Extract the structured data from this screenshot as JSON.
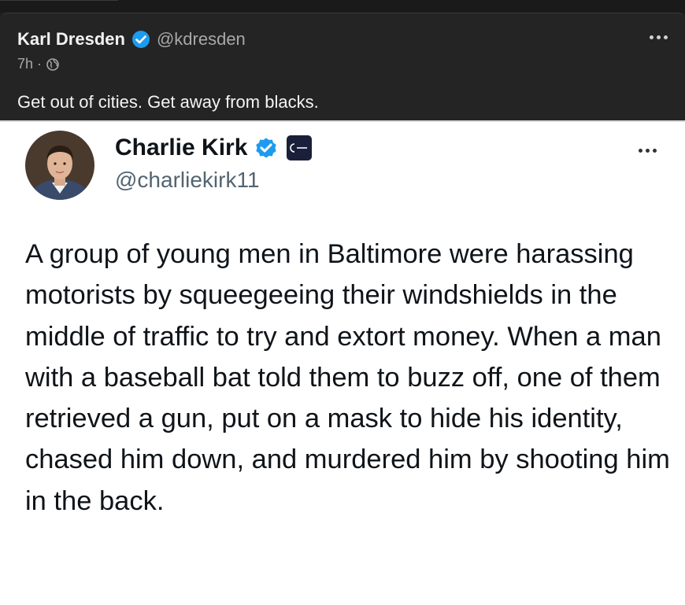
{
  "outer_post": {
    "author_name": "Karl Dresden",
    "handle": "@kdresden",
    "time": "7h",
    "separator": "·",
    "text": "Get out of cities. Get away from blacks."
  },
  "embedded_post": {
    "author_name": "Charlie Kirk",
    "handle": "@charliekirk11",
    "text": "A group of young men in Baltimore were harassing motorists by squeegeeing their windshields in the middle of traffic to try and extort money. When a man with a baseball bat told them to buzz off, one of them retrieved a gun, put on a mask to hide his identity, chased him down, and murdered him by shooting him in the back."
  },
  "icons": {
    "verified": "verified-badge-icon",
    "globe": "globe-icon",
    "more": "more-options-icon",
    "org": "organization-badge-icon"
  },
  "colors": {
    "dark_background": "#242424",
    "verified_blue": "#1d9bf0",
    "light_text": "#f4f4f4",
    "muted_text": "#a8a8a8",
    "embedded_background": "#ffffff",
    "handle_gray": "#536471"
  }
}
